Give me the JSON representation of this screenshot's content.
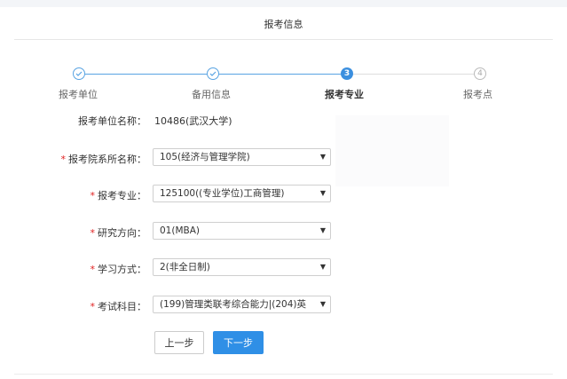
{
  "header": {
    "title": "报考信息"
  },
  "steps": [
    {
      "label": "报考单位",
      "state": "done",
      "icon": "check-icon"
    },
    {
      "label": "备用信息",
      "state": "done",
      "icon": "check-icon"
    },
    {
      "label": "报考专业",
      "state": "active",
      "number": "3"
    },
    {
      "label": "报考点",
      "state": "todo",
      "number": "4"
    }
  ],
  "form": {
    "unit": {
      "label": "报考单位名称：",
      "value": "10486(武汉大学)"
    },
    "department": {
      "label": "报考院系所名称：",
      "value": "105(经济与管理学院)",
      "required": "*"
    },
    "major": {
      "label": "报考专业：",
      "value": "125100((专业学位)工商管理)",
      "required": "*"
    },
    "direction": {
      "label": "研究方向：",
      "value": "01(MBA)",
      "required": "*"
    },
    "study_mode": {
      "label": "学习方式：",
      "value": "2(非全日制)",
      "required": "*"
    },
    "subjects": {
      "label": "考试科目：",
      "value": "(199)管理类联考综合能力|(204)英",
      "required": "*"
    }
  },
  "select_arrow": "▼",
  "buttons": {
    "prev": "上一步",
    "next": "下一步"
  },
  "colors": {
    "accent": "#2f8fe6",
    "required": "#e02020",
    "step_done": "#58a3e2",
    "step_todo": "#bbbbbb"
  }
}
